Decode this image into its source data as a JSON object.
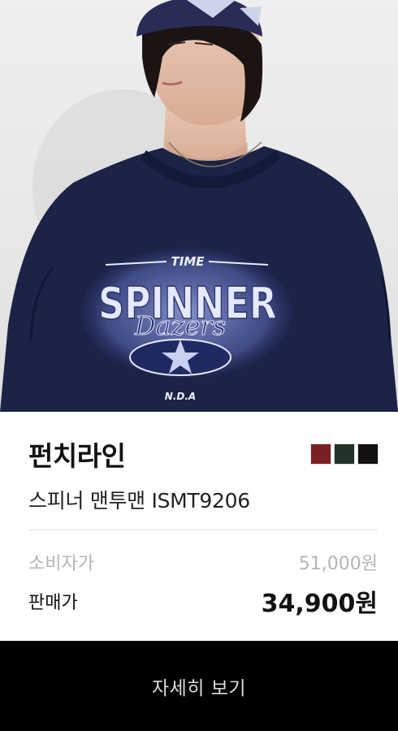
{
  "product": {
    "image_graphic_text": {
      "line1": "TIME",
      "line2": "SPINNER",
      "line3": "Dazers",
      "line4": "N.D.A"
    },
    "brand": "펀치라인",
    "name": "스피너 맨투맨 ISMT9206",
    "color_options": [
      {
        "name": "burgundy",
        "color": "#7a1f24"
      },
      {
        "name": "dark-green",
        "color": "#1f3327"
      },
      {
        "name": "black",
        "color": "#111111"
      }
    ],
    "retail_price_label": "소비자가",
    "retail_price": "51,000원",
    "sale_price_label": "판매가",
    "sale_price": "34,900원"
  },
  "cta": {
    "label": "자세히 보기"
  }
}
